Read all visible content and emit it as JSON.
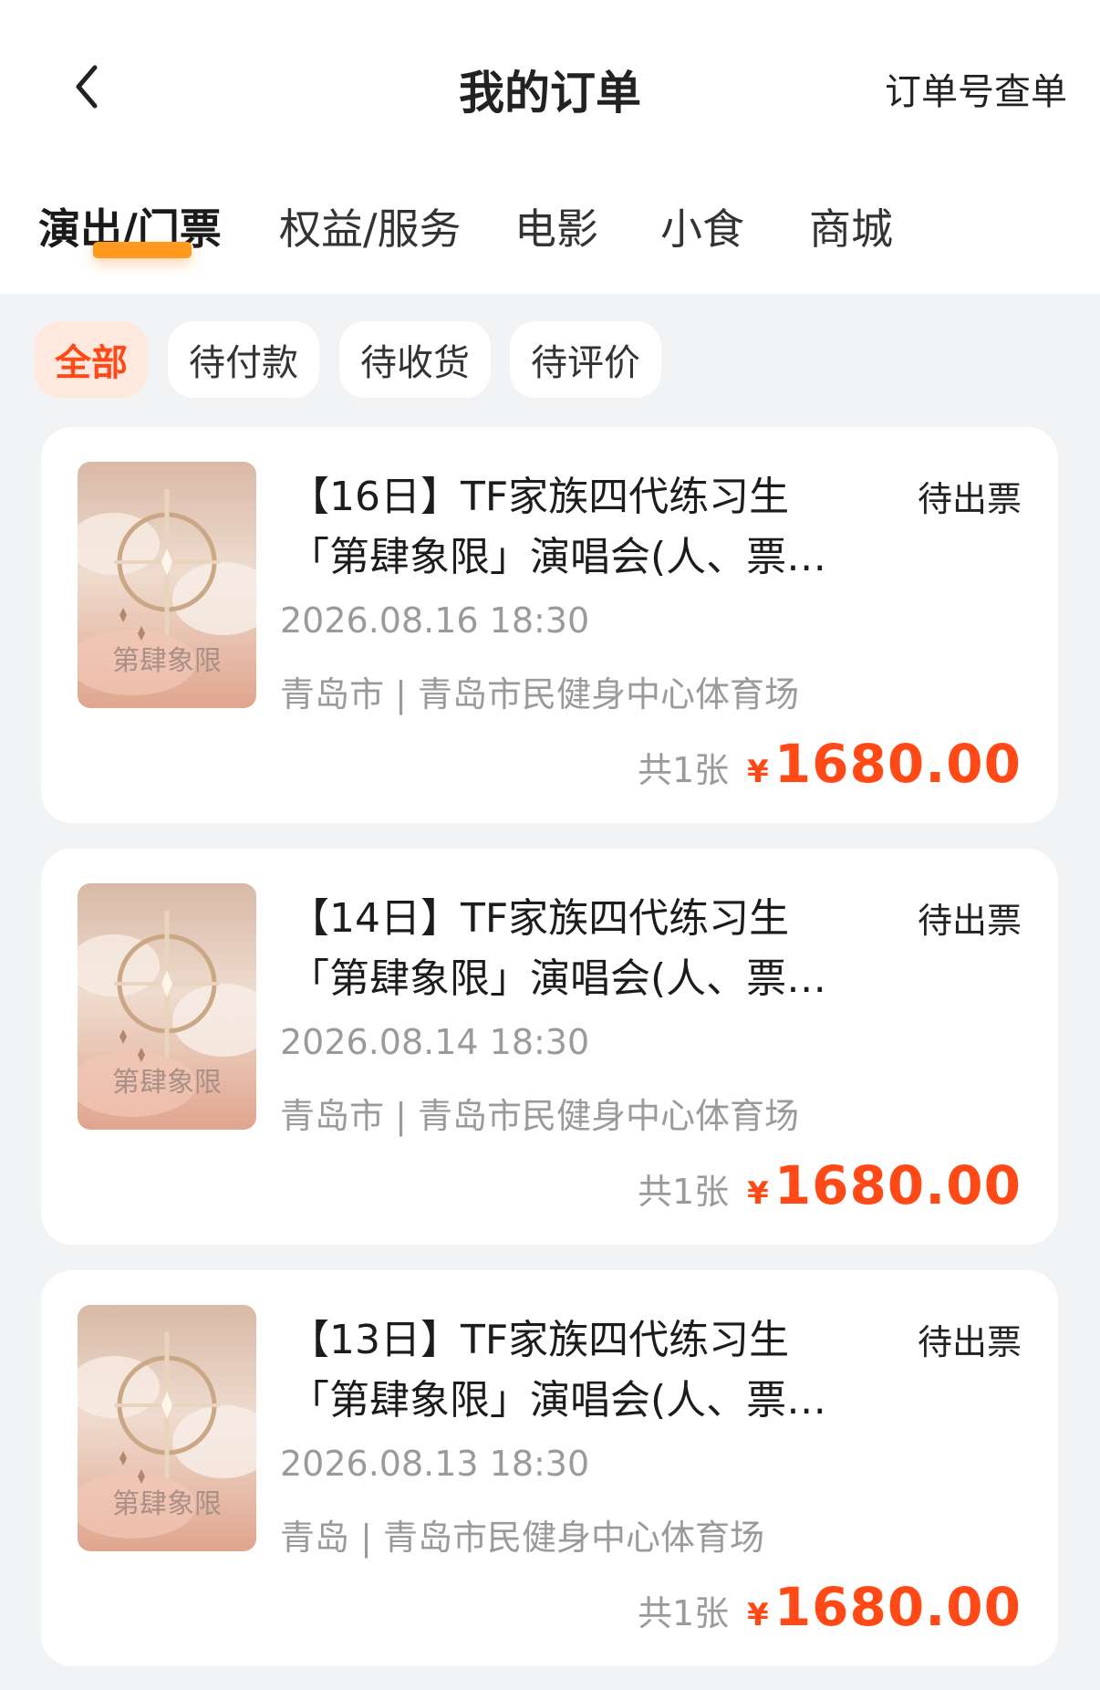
{
  "header": {
    "title": "我的订单",
    "order_search": "订单号查单",
    "back_icon": "chevron-left-icon"
  },
  "tabs": [
    {
      "label": "演出/门票",
      "active": true
    },
    {
      "label": "权益/服务",
      "active": false
    },
    {
      "label": "电影",
      "active": false
    },
    {
      "label": "小食",
      "active": false
    },
    {
      "label": "商城",
      "active": false
    }
  ],
  "filters": [
    {
      "label": "全部",
      "active": true
    },
    {
      "label": "待付款",
      "active": false
    },
    {
      "label": "待收货",
      "active": false
    },
    {
      "label": "待评价",
      "active": false
    }
  ],
  "orders": [
    {
      "title_line1": "【16日】TF家族四代练习生",
      "title_line2": "「第肆象限」演唱会(人、票…",
      "status": "待出票",
      "datetime": "2026.08.16 18:30",
      "venue": "青岛市 | 青岛市民健身中心体育场",
      "qty": "共1张",
      "currency": "¥",
      "amount": "1680.00",
      "poster_text": "第肆象限"
    },
    {
      "title_line1": "【14日】TF家族四代练习生",
      "title_line2": "「第肆象限」演唱会(人、票…",
      "status": "待出票",
      "datetime": "2026.08.14 18:30",
      "venue": "青岛市 | 青岛市民健身中心体育场",
      "qty": "共1张",
      "currency": "¥",
      "amount": "1680.00",
      "poster_text": "第肆象限"
    },
    {
      "title_line1": "【13日】TF家族四代练习生",
      "title_line2": "「第肆象限」演唱会(人、票…",
      "status": "待出票",
      "datetime": "2026.08.13 18:30",
      "venue": "青岛 | 青岛市民健身中心体育场",
      "qty": "共1张",
      "currency": "¥",
      "amount": "1680.00",
      "poster_text": "第肆象限"
    }
  ],
  "colors": {
    "accent": "#ff4a17",
    "tab_indicator": "#ff9a1f",
    "chip_active_bg": "#ffe9df",
    "page_bg": "#f2f3f5"
  }
}
